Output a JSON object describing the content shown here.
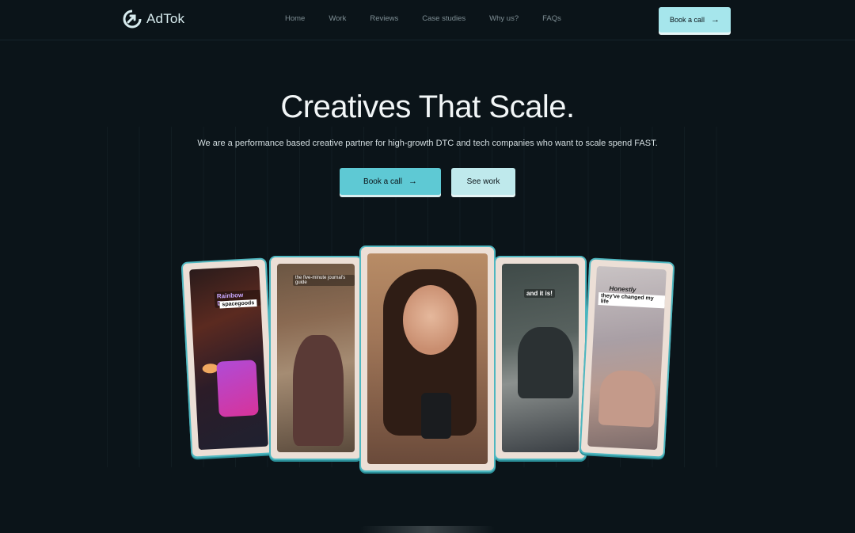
{
  "brand": {
    "name": "AdTok",
    "logo_icon": "adtok-logo-icon"
  },
  "nav": {
    "links": [
      "Home",
      "Work",
      "Reviews",
      "Case studies",
      "Why us?",
      "FAQs"
    ],
    "cta_label": "Book a call"
  },
  "hero": {
    "title": "Creatives That Scale.",
    "subtitle": "We are a performance based creative partner for high-growth DTC and tech companies who want to scale spend FAST.",
    "primary_cta": "Book a call",
    "secondary_cta": "See work"
  },
  "cards": [
    {
      "overlay_text": "Rainbow Dust",
      "tag": "spacegoods"
    },
    {
      "overlay_text": "the five-minute journal's guide"
    },
    {
      "overlay_text": ""
    },
    {
      "overlay_text": "and it is!"
    },
    {
      "overlay_text": "Honestly",
      "tag": "they've changed my life"
    }
  ],
  "colors": {
    "background": "#0b1419",
    "accent": "#5ec9d4",
    "accent_light": "#a6e6ec",
    "card_frame": "#ecdfd6"
  }
}
